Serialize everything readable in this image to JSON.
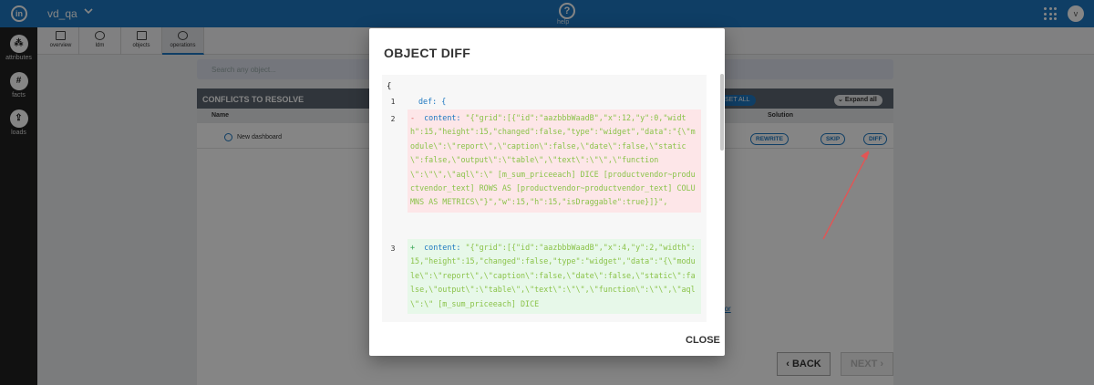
{
  "topbar": {
    "logo": "in",
    "project": "vd_qa",
    "help_label": "help",
    "avatar": "v"
  },
  "rail": [
    {
      "label": "attributes",
      "icon": "nodes-icon"
    },
    {
      "label": "facts",
      "icon": "hash-icon"
    },
    {
      "label": "loads",
      "icon": "upload-icon"
    }
  ],
  "subnav": [
    {
      "label": "overview"
    },
    {
      "label": "ldm"
    },
    {
      "label": "objects"
    },
    {
      "label": "operations"
    }
  ],
  "background": {
    "search_placeholder": "Search any object...",
    "conflicts_title": "CONFLICTS TO RESOLVE",
    "reset_all": "SET ALL",
    "expand_all": "Expand all",
    "col_name": "Name",
    "col_solution": "Solution",
    "row_name": "New dashboard",
    "rewrite": "REWRITE",
    "skip": "SKIP",
    "diff": "DIFF",
    "close_editor": "Close editor",
    "back": "BACK",
    "next": "NEXT"
  },
  "modal": {
    "title": "OBJECT DIFF",
    "open_brace": "{",
    "line1_no": "1",
    "line1_text": "def: {",
    "line2_no": "2",
    "line2_sign": "-",
    "line2_key": "content:",
    "line2_value": "\"{\"grid\":[{\"id\":\"aazbbbWaadB\",\"x\":12,\"y\":0,\"width\":15,\"height\":15,\"changed\":false,\"type\":\"widget\",\"data\":\"{\\\"module\\\":\\\"report\\\",\\\"caption\\\":false,\\\"date\\\":false,\\\"static\\\":false,\\\"output\\\":\\\"table\\\",\\\"text\\\":\\\"\\\",\\\"function\\\":\\\"\\\",\\\"aql\\\":\\\" [m_sum_priceeach] DICE [productvendor~productvendor_text] ROWS AS [productvendor~productvendor_text] COLUMNS AS METRICS\\\"}\",\"w\":15,\"h\":15,\"isDraggable\":true}]}\",",
    "line3_no": "3",
    "line3_sign": "+",
    "line3_key": "content:",
    "line3_value": "\"{\"grid\":[{\"id\":\"aazbbbWaadB\",\"x\":4,\"y\":2,\"width\":15,\"height\":15,\"changed\":false,\"type\":\"widget\",\"data\":\"{\\\"module\\\":\\\"report\\\",\\\"caption\\\":false,\\\"date\\\":false,\\\"static\\\":false,\\\"output\\\":\\\"table\\\",\\\"text\\\":\\\"\\\",\\\"function\\\":\\\"\\\",\\\"aql\\\":\\\" [m_sum_priceeach] DICE",
    "close": "CLOSE"
  },
  "colors": {
    "brand": "#1d78c1",
    "removed_bg": "#fde6e8",
    "added_bg": "#e7f8e9",
    "string": "#8bc34a"
  }
}
